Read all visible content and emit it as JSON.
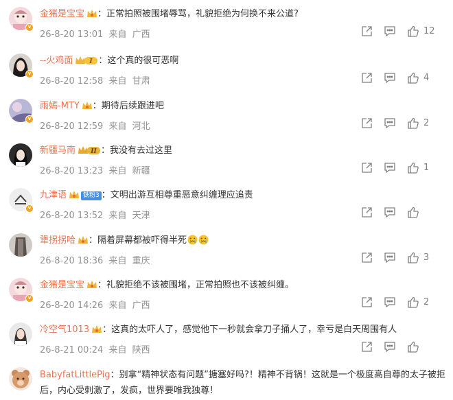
{
  "comments": [
    {
      "username": "金猪是宝宝",
      "text": "正常拍照被围堵辱骂，礼貌拒绝为何换不来公道?",
      "timestamp": "26-8-20 13:01",
      "location_prefix": "来自",
      "location": "广西",
      "likes": "12",
      "avatar": "cartoon-avatar",
      "verified": true,
      "medal": "crown-badge"
    },
    {
      "username": "--火鸡面",
      "text": "这个真的很可恶啊",
      "timestamp": "26-8-20 12:58",
      "location_prefix": "来自",
      "location": "甘肃",
      "likes": "4",
      "avatar": "portrait-avatar",
      "verified": true,
      "medal": "vip-level-1-badge",
      "medal_text": "I"
    },
    {
      "username": "雨嫣-MTY",
      "text": "期待后续跟进吧",
      "timestamp": "26-8-20 12:59",
      "location_prefix": "来自",
      "location": "河北",
      "likes": "2",
      "avatar": "photo-avatar",
      "verified": true,
      "medal": "crown-badge"
    },
    {
      "username": "新疆马南",
      "text": "我没有去过这里",
      "timestamp": "26-8-20 13:23",
      "location_prefix": "来自",
      "location": "新疆",
      "likes": "1",
      "avatar": "portrait-avatar",
      "verified": false,
      "medal": "vip-level-2-badge",
      "medal_text": "II"
    },
    {
      "username": "九津语",
      "text": "文明出游互相尊重恶意纠缠理应追责",
      "timestamp": "26-8-20 13:52",
      "location_prefix": "来自",
      "location": "天津",
      "likes": "",
      "avatar": "logo-avatar",
      "verified": true,
      "medal": "crown-badge",
      "fan_badge": "铁粉3"
    },
    {
      "username": "犟拐拐哈",
      "text": "隔着屏幕都被吓得半死",
      "timestamp": "26-8-20 18:36",
      "location_prefix": "来自",
      "location": "重庆",
      "likes": "3",
      "avatar": "photo-avatar",
      "verified": false,
      "medal": "crown-badge",
      "emojis": [
        "crying-face-emoji",
        "crying-face-emoji"
      ]
    },
    {
      "username": "金猪是宝宝",
      "text": "礼貌拒绝不该被围堵，正常拍照也不该被纠缠。",
      "timestamp": "26-8-20 14:26",
      "location_prefix": "来自",
      "location": "广西",
      "likes": "2",
      "avatar": "cartoon-avatar",
      "verified": true,
      "medal": "crown-badge"
    },
    {
      "username": "冷空气1013",
      "text": "这真的太吓人了，感觉他下一秒就会拿刀子捅人了，幸亏是白天周围有人",
      "timestamp": "26-8-21 00:24",
      "location_prefix": "来自",
      "location": "陕西",
      "likes": "",
      "avatar": "portrait-avatar",
      "verified": false,
      "medal": "crown-badge"
    },
    {
      "username": "BabyfatLittlePig",
      "text": "别拿“精神状态有问题”搪塞好吗?！精神不背锅！这就是一个极度高自尊的太子被拒后，内心受刺激了，发疯，世界要唯我独尊！",
      "timestamp": "",
      "location_prefix": "",
      "location": "",
      "likes": "",
      "avatar": "teddy-bear-avatar",
      "verified": false,
      "medal": ""
    }
  ],
  "colors": {
    "username": "#eb7350",
    "meta": "#939393",
    "icon": "#808080",
    "verified": "#f7a21c",
    "fan_badge": "#4a90e2"
  }
}
